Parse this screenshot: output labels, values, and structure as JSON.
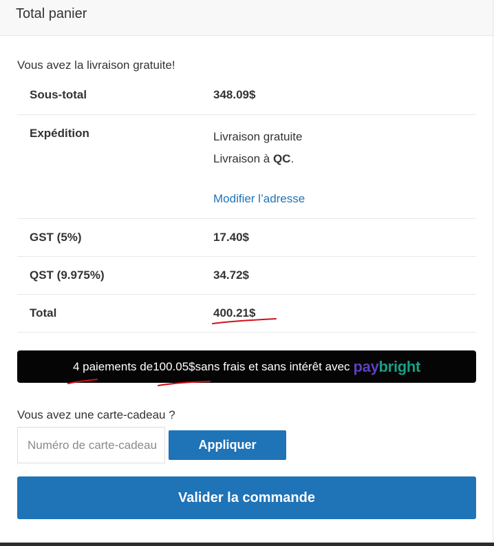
{
  "header": {
    "title": "Total panier"
  },
  "notice": {
    "free_shipping": "Vous avez la livraison gratuite!"
  },
  "totals": {
    "subtotal": {
      "label": "Sous-total",
      "value": "348.09$"
    },
    "shipping": {
      "label": "Expédition",
      "method": "Livraison gratuite",
      "destination_prefix": "Livraison à ",
      "destination_region": "QC",
      "destination_suffix": ".",
      "modify_link": "Modifier l’adresse"
    },
    "gst": {
      "label": "GST (5%)",
      "value": "17.40$"
    },
    "qst": {
      "label": "QST (9.975%)",
      "value": "34.72$"
    },
    "total": {
      "label": "Total",
      "value": "400.21$"
    }
  },
  "paybright": {
    "prefix": "4 paiements de ",
    "amount": "100.05$",
    "suffix": " sans frais et sans intérêt avec",
    "logo_pay": "pay",
    "logo_bright": "bright"
  },
  "gift_card": {
    "question": "Vous avez une carte-cadeau ?",
    "placeholder": "Numéro de carte-cadeau",
    "value": "",
    "apply_label": "Appliquer"
  },
  "checkout": {
    "label": "Valider la commande"
  },
  "colors": {
    "accent": "#1f73b7",
    "annotation": "#d0101a",
    "paybright_pay": "#5e3fbf",
    "paybright_bright": "#16a085"
  }
}
